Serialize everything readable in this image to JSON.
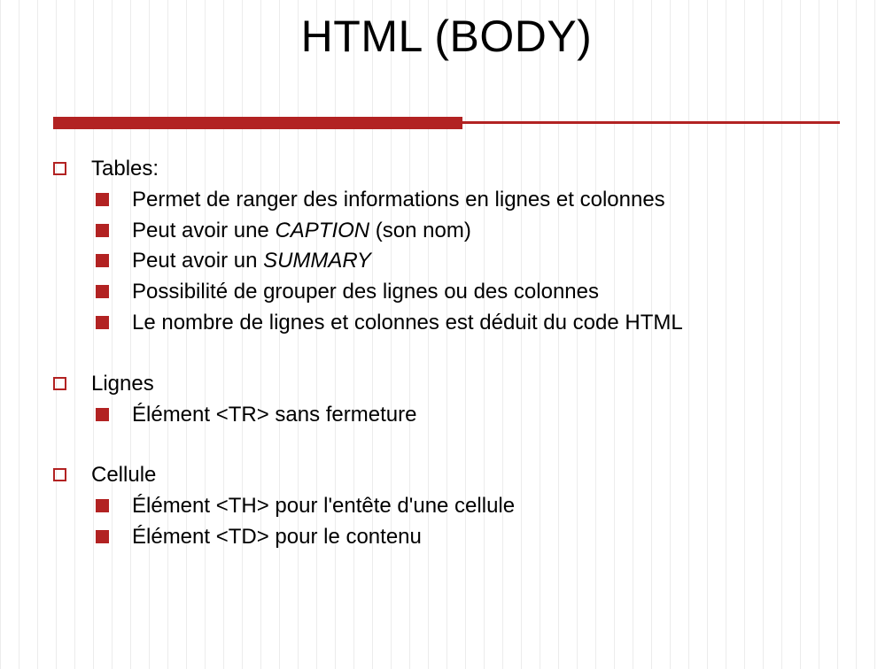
{
  "title": "HTML (BODY)",
  "sections": [
    {
      "heading": "Tables:",
      "items": [
        "Permet de ranger des informations en lignes et colonnes",
        "Peut avoir une <i>CAPTION</i> (son nom)",
        "Peut avoir un <i>SUMMARY</i>",
        "Possibilité de grouper des lignes ou des colonnes",
        "Le nombre de lignes et colonnes est déduit du code HTML"
      ]
    },
    {
      "heading": "Lignes",
      "items": [
        "Élément <TR> sans fermeture"
      ]
    },
    {
      "heading": "Cellule",
      "items": [
        "Élément <TH> pour l'entête d'une cellule",
        "Élément <TD> pour le contenu"
      ]
    }
  ]
}
